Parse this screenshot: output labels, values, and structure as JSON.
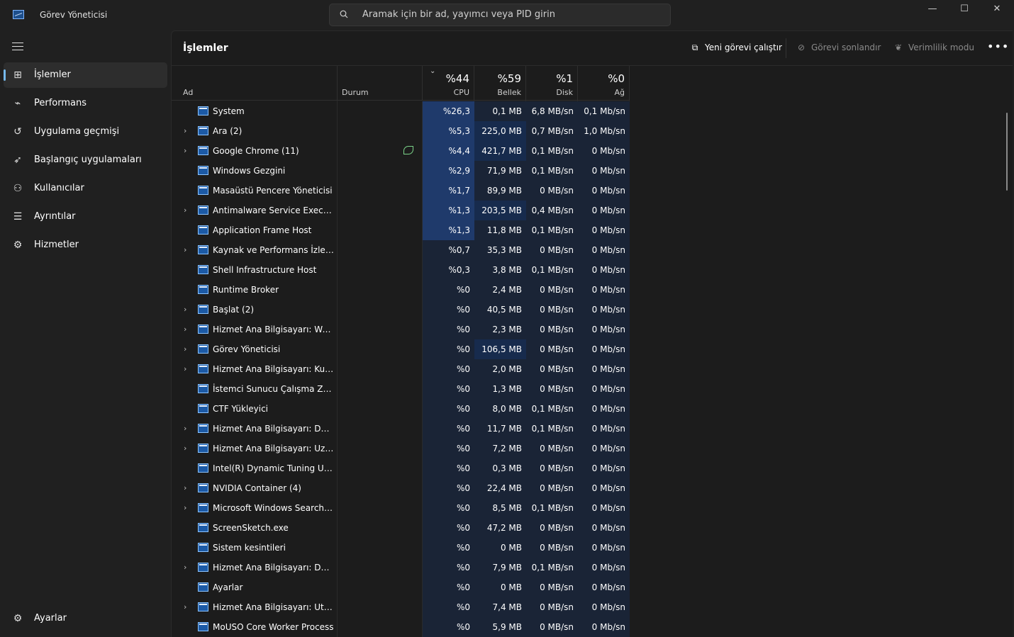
{
  "app": {
    "title": "Görev Yöneticisi"
  },
  "search": {
    "placeholder": "Aramak için bir ad, yayımcı veya PID girin"
  },
  "window_controls": {
    "minimize": "—",
    "maximize": "☐",
    "close": "✕"
  },
  "sidebar": {
    "items": [
      {
        "label": "İşlemler",
        "icon": "processes-icon",
        "glyph": "⊞",
        "active": true
      },
      {
        "label": "Performans",
        "icon": "performance-icon",
        "glyph": "⌁",
        "active": false
      },
      {
        "label": "Uygulama geçmişi",
        "icon": "history-icon",
        "glyph": "↺",
        "active": false
      },
      {
        "label": "Başlangıç uygulamaları",
        "icon": "startup-icon",
        "glyph": "➶",
        "active": false
      },
      {
        "label": "Kullanıcılar",
        "icon": "users-icon",
        "glyph": "⚇",
        "active": false
      },
      {
        "label": "Ayrıntılar",
        "icon": "details-icon",
        "glyph": "☰",
        "active": false
      },
      {
        "label": "Hizmetler",
        "icon": "services-icon",
        "glyph": "⚙",
        "active": false
      }
    ],
    "settings": {
      "label": "Ayarlar",
      "icon": "settings-icon"
    }
  },
  "toolbar": {
    "title": "İşlemler",
    "run_task": "Yeni görevi çalıştır",
    "end_task": "Görevi sonlandır",
    "efficiency": "Verimlilik modu",
    "more": "•••"
  },
  "columns": {
    "name": "Ad",
    "status": "Durum",
    "cpu": {
      "pct": "%44",
      "label": "CPU"
    },
    "mem": {
      "pct": "%59",
      "label": "Bellek"
    },
    "disk": {
      "pct": "%1",
      "label": "Disk"
    },
    "net": {
      "pct": "%0",
      "label": "Ağ"
    }
  },
  "colors": {
    "accent": "#76b9ed",
    "heat_high": "#1f3a6b",
    "heat_mid": "#172b4d",
    "heat_low": "#1a2436"
  },
  "rows": [
    {
      "name": "System",
      "expand": false,
      "cpu": "%26,3",
      "mem": "0,1 MB",
      "disk": "6,8 MB/sn",
      "net": "0,1 Mb/sn",
      "cpu_heat": 3,
      "mem_heat": 1,
      "disk_heat": 1,
      "net_heat": 1
    },
    {
      "name": "Ara (2)",
      "expand": true,
      "cpu": "%5,3",
      "mem": "225,0 MB",
      "disk": "0,7 MB/sn",
      "net": "1,0 Mb/sn",
      "cpu_heat": 3,
      "mem_heat": 2,
      "disk_heat": 1,
      "net_heat": 1
    },
    {
      "name": "Google Chrome (11)",
      "expand": true,
      "cpu": "%4,4",
      "mem": "421,7 MB",
      "disk": "0,1 MB/sn",
      "net": "0 Mb/sn",
      "cpu_heat": 3,
      "mem_heat": 2,
      "disk_heat": 1,
      "net_heat": 1,
      "efficiency": true
    },
    {
      "name": "Windows Gezgini",
      "expand": false,
      "cpu": "%2,9",
      "mem": "71,9 MB",
      "disk": "0,1 MB/sn",
      "net": "0 Mb/sn",
      "cpu_heat": 3,
      "mem_heat": 1,
      "disk_heat": 1,
      "net_heat": 1
    },
    {
      "name": "Masaüstü Pencere Yöneticisi",
      "expand": false,
      "cpu": "%1,7",
      "mem": "89,9 MB",
      "disk": "0 MB/sn",
      "net": "0 Mb/sn",
      "cpu_heat": 3,
      "mem_heat": 1,
      "disk_heat": 1,
      "net_heat": 1
    },
    {
      "name": "Antimalware Service Executable",
      "expand": true,
      "cpu": "%1,3",
      "mem": "203,5 MB",
      "disk": "0,4 MB/sn",
      "net": "0 Mb/sn",
      "cpu_heat": 3,
      "mem_heat": 2,
      "disk_heat": 1,
      "net_heat": 1
    },
    {
      "name": "Application Frame Host",
      "expand": false,
      "cpu": "%1,3",
      "mem": "11,8 MB",
      "disk": "0,1 MB/sn",
      "net": "0 Mb/sn",
      "cpu_heat": 3,
      "mem_heat": 1,
      "disk_heat": 1,
      "net_heat": 1
    },
    {
      "name": "Kaynak ve Performans İzleyicisi",
      "expand": true,
      "cpu": "%0,7",
      "mem": "35,3 MB",
      "disk": "0 MB/sn",
      "net": "0 Mb/sn",
      "cpu_heat": 1,
      "mem_heat": 1,
      "disk_heat": 1,
      "net_heat": 1
    },
    {
      "name": "Shell Infrastructure Host",
      "expand": false,
      "cpu": "%0,3",
      "mem": "3,8 MB",
      "disk": "0,1 MB/sn",
      "net": "0 Mb/sn",
      "cpu_heat": 1,
      "mem_heat": 1,
      "disk_heat": 1,
      "net_heat": 1
    },
    {
      "name": "Runtime Broker",
      "expand": false,
      "cpu": "%0",
      "mem": "2,4 MB",
      "disk": "0 MB/sn",
      "net": "0 Mb/sn",
      "cpu_heat": 1,
      "mem_heat": 1,
      "disk_heat": 1,
      "net_heat": 1
    },
    {
      "name": "Başlat (2)",
      "expand": true,
      "cpu": "%0",
      "mem": "40,5 MB",
      "disk": "0 MB/sn",
      "net": "0 Mb/sn",
      "cpu_heat": 1,
      "mem_heat": 1,
      "disk_heat": 1,
      "net_heat": 1
    },
    {
      "name": "Hizmet Ana Bilgisayarı: Web H...",
      "expand": true,
      "cpu": "%0",
      "mem": "2,3 MB",
      "disk": "0 MB/sn",
      "net": "0 Mb/sn",
      "cpu_heat": 1,
      "mem_heat": 1,
      "disk_heat": 1,
      "net_heat": 1
    },
    {
      "name": "Görev Yöneticisi",
      "expand": true,
      "cpu": "%0",
      "mem": "106,5 MB",
      "disk": "0 MB/sn",
      "net": "0 Mb/sn",
      "cpu_heat": 1,
      "mem_heat": 2,
      "disk_heat": 1,
      "net_heat": 1
    },
    {
      "name": "Hizmet Ana Bilgisayarı: Kullanı...",
      "expand": true,
      "cpu": "%0",
      "mem": "2,0 MB",
      "disk": "0 MB/sn",
      "net": "0 Mb/sn",
      "cpu_heat": 1,
      "mem_heat": 1,
      "disk_heat": 1,
      "net_heat": 1
    },
    {
      "name": "İstemci Sunucu Çalışma Zama...",
      "expand": false,
      "cpu": "%0",
      "mem": "1,3 MB",
      "disk": "0 MB/sn",
      "net": "0 Mb/sn",
      "cpu_heat": 1,
      "mem_heat": 1,
      "disk_heat": 1,
      "net_heat": 1
    },
    {
      "name": "CTF Yükleyici",
      "expand": false,
      "cpu": "%0",
      "mem": "8,0 MB",
      "disk": "0,1 MB/sn",
      "net": "0 Mb/sn",
      "cpu_heat": 1,
      "mem_heat": 1,
      "disk_heat": 1,
      "net_heat": 1
    },
    {
      "name": "Hizmet Ana Bilgisayarı: Duru...",
      "expand": true,
      "cpu": "%0",
      "mem": "11,7 MB",
      "disk": "0,1 MB/sn",
      "net": "0 Mb/sn",
      "cpu_heat": 1,
      "mem_heat": 1,
      "disk_heat": 1,
      "net_heat": 1
    },
    {
      "name": "Hizmet Ana Bilgisayarı: Uzakta...",
      "expand": true,
      "cpu": "%0",
      "mem": "7,2 MB",
      "disk": "0 MB/sn",
      "net": "0 Mb/sn",
      "cpu_heat": 1,
      "mem_heat": 1,
      "disk_heat": 1,
      "net_heat": 1
    },
    {
      "name": "Intel(R) Dynamic Tuning Utilit...",
      "expand": false,
      "cpu": "%0",
      "mem": "0,3 MB",
      "disk": "0 MB/sn",
      "net": "0 Mb/sn",
      "cpu_heat": 1,
      "mem_heat": 1,
      "disk_heat": 1,
      "net_heat": 1
    },
    {
      "name": "NVIDIA Container (4)",
      "expand": true,
      "cpu": "%0",
      "mem": "22,4 MB",
      "disk": "0 MB/sn",
      "net": "0 Mb/sn",
      "cpu_heat": 1,
      "mem_heat": 1,
      "disk_heat": 1,
      "net_heat": 1
    },
    {
      "name": "Microsoft Windows Search Diz...",
      "expand": true,
      "cpu": "%0",
      "mem": "8,5 MB",
      "disk": "0,1 MB/sn",
      "net": "0 Mb/sn",
      "cpu_heat": 1,
      "mem_heat": 1,
      "disk_heat": 1,
      "net_heat": 1
    },
    {
      "name": "ScreenSketch.exe",
      "expand": false,
      "cpu": "%0",
      "mem": "47,2 MB",
      "disk": "0 MB/sn",
      "net": "0 Mb/sn",
      "cpu_heat": 1,
      "mem_heat": 1,
      "disk_heat": 1,
      "net_heat": 1
    },
    {
      "name": "Sistem kesintileri",
      "expand": false,
      "cpu": "%0",
      "mem": "0 MB",
      "disk": "0 MB/sn",
      "net": "0 Mb/sn",
      "cpu_heat": 1,
      "mem_heat": 1,
      "disk_heat": 1,
      "net_heat": 1
    },
    {
      "name": "Hizmet Ana Bilgisayarı: DCOM...",
      "expand": true,
      "cpu": "%0",
      "mem": "7,9 MB",
      "disk": "0,1 MB/sn",
      "net": "0 Mb/sn",
      "cpu_heat": 1,
      "mem_heat": 1,
      "disk_heat": 1,
      "net_heat": 1
    },
    {
      "name": "Ayarlar",
      "expand": false,
      "cpu": "%0",
      "mem": "0 MB",
      "disk": "0 MB/sn",
      "net": "0 Mb/sn",
      "cpu_heat": 1,
      "mem_heat": 1,
      "disk_heat": 1,
      "net_heat": 1
    },
    {
      "name": "Hizmet Ana Bilgisayarı: UtcSvc",
      "expand": true,
      "cpu": "%0",
      "mem": "7,4 MB",
      "disk": "0 MB/sn",
      "net": "0 Mb/sn",
      "cpu_heat": 1,
      "mem_heat": 1,
      "disk_heat": 1,
      "net_heat": 1
    },
    {
      "name": "MoUSO Core Worker Process",
      "expand": false,
      "cpu": "%0",
      "mem": "5,9 MB",
      "disk": "0 MB/sn",
      "net": "0 Mb/sn",
      "cpu_heat": 1,
      "mem_heat": 1,
      "disk_heat": 1,
      "net_heat": 1
    }
  ]
}
